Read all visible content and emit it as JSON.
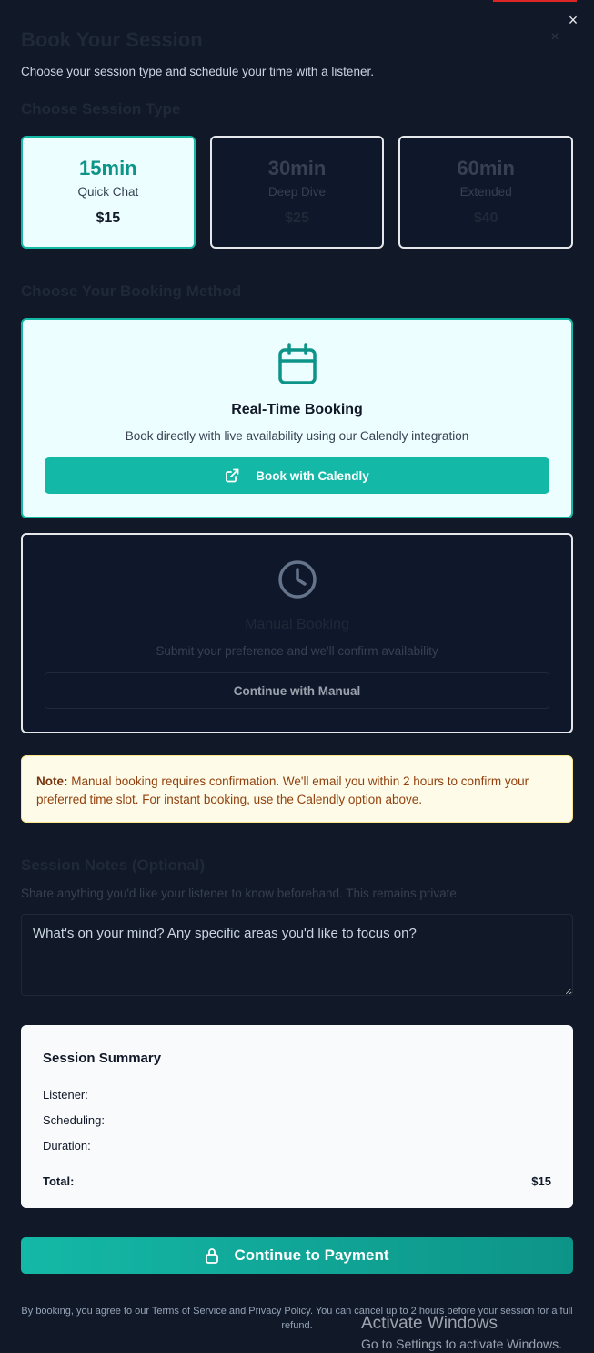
{
  "modal": {
    "title": "Book Your Session",
    "subtitle": "Choose your session type and schedule your time with a listener.",
    "close_glyph": "×"
  },
  "session_type": {
    "heading": "Choose Session Type",
    "options": [
      {
        "duration": "15min",
        "label": "Quick Chat",
        "price": "$15",
        "selected": true
      },
      {
        "duration": "30min",
        "label": "Deep Dive",
        "price": "$25",
        "selected": false
      },
      {
        "duration": "60min",
        "label": "Extended",
        "price": "$40",
        "selected": false
      }
    ]
  },
  "booking_method": {
    "heading": "Choose Your Booking Method",
    "realtime": {
      "icon": "calendar-icon",
      "title": "Real-Time Booking",
      "description": "Book directly with live availability using our Calendly integration",
      "button_icon": "external-link-icon",
      "button_label": "Book with Calendly"
    },
    "manual": {
      "icon": "clock-icon",
      "title": "Manual Booking",
      "description": "Submit your preference and we'll confirm availability",
      "button_label": "Continue with Manual"
    }
  },
  "note": {
    "label": "Note:",
    "text": "Manual booking requires confirmation. We'll email you within 2 hours to confirm your preferred time slot. For instant booking, use the Calendly option above."
  },
  "session_notes": {
    "heading": "Session Notes (Optional)",
    "help": "Share anything you'd like your listener to know beforehand. This remains private.",
    "placeholder": "What's on your mind? Any specific areas you'd like to focus on?"
  },
  "summary": {
    "heading": "Session Summary",
    "listener_label": "Listener:",
    "scheduling_label": "Scheduling:",
    "duration_label": "Duration:",
    "total_label": "Total:",
    "total_value": "$15"
  },
  "payment": {
    "button_icon": "lock-icon",
    "button_label": "Continue to Payment"
  },
  "footer": {
    "text": "By booking, you agree to our Terms of Service and Privacy Policy. You can cancel up to 2 hours before your session for a full refund."
  },
  "watermark": {
    "line1": "Activate Windows",
    "line2": "Go to Settings to activate Windows."
  },
  "colors": {
    "accent": "#14b8a6",
    "background": "#111827",
    "note_bg": "#fefce8"
  }
}
